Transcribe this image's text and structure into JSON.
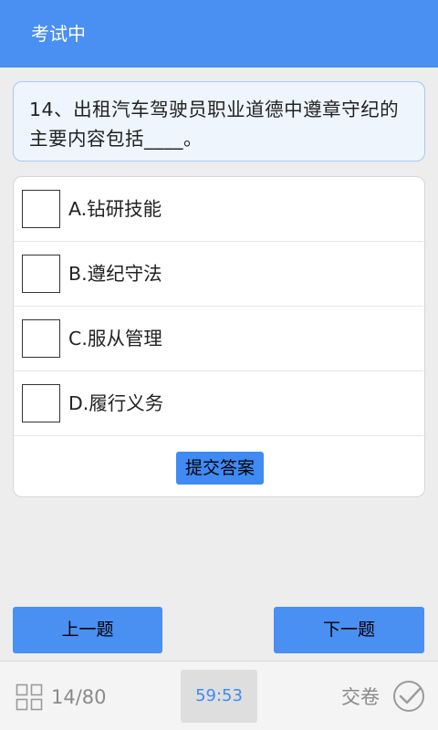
{
  "header": {
    "title": "考试中"
  },
  "question": {
    "text": "14、出租汽车驾驶员职业道德中遵章守纪的主要内容包括____。"
  },
  "options": [
    {
      "label": "A.钻研技能",
      "checked": false
    },
    {
      "label": "B.遵纪守法",
      "checked": false
    },
    {
      "label": "C.服从管理",
      "checked": false
    },
    {
      "label": "D.履行义务",
      "checked": false
    }
  ],
  "submit": {
    "label": "提交答案"
  },
  "nav": {
    "prev_label": "上一题",
    "next_label": "下一题"
  },
  "footer": {
    "grid_icon": "grid-icon",
    "progress": "14/80",
    "timer": "59:53",
    "hand_in_label": "交卷",
    "check_icon": "check-circle-icon"
  },
  "colors": {
    "accent": "#4a8ff2",
    "timer_text": "#3f8af3",
    "background": "#ededed"
  }
}
